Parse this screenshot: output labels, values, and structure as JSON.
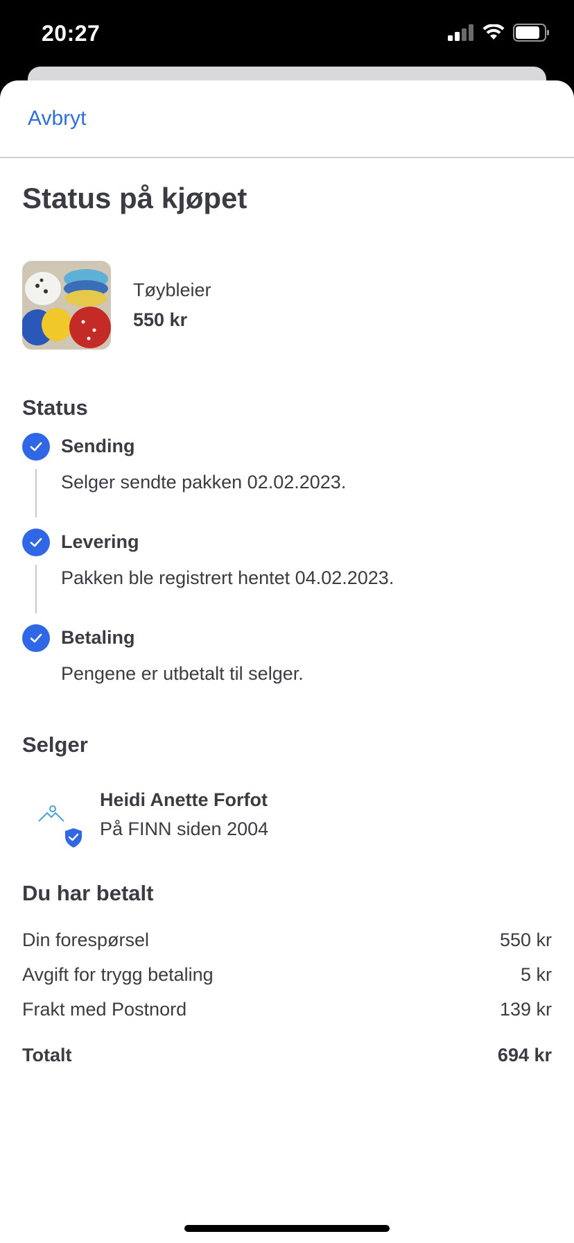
{
  "status_bar": {
    "time": "20:27"
  },
  "nav": {
    "cancel_label": "Avbryt"
  },
  "page": {
    "title": "Status på kjøpet"
  },
  "item": {
    "name": "Tøybleier",
    "price": "550 kr"
  },
  "status": {
    "heading": "Status",
    "steps": [
      {
        "title": "Sending",
        "text": "Selger sendte pakken 02.02.2023."
      },
      {
        "title": "Levering",
        "text": "Pakken ble registrert hentet 04.02.2023."
      },
      {
        "title": "Betaling",
        "text": "Pengene er utbetalt til selger."
      }
    ]
  },
  "seller": {
    "heading": "Selger",
    "name": "Heidi Anette Forfot",
    "since": "På FINN siden 2004"
  },
  "payment": {
    "heading": "Du har betalt",
    "rows": [
      {
        "label": "Din forespørsel",
        "value": "550 kr"
      },
      {
        "label": "Avgift for trygg betaling",
        "value": "5 kr"
      },
      {
        "label": "Frakt med Postnord",
        "value": "139 kr"
      }
    ],
    "total": {
      "label": "Totalt",
      "value": "694 kr"
    }
  },
  "colors": {
    "accent": "#2f6fdb",
    "check": "#2f67e6",
    "text": "#3b3b44"
  },
  "icons": {
    "check": "check-icon",
    "avatar": "mountain-avatar-icon",
    "verified": "shield-check-icon"
  }
}
